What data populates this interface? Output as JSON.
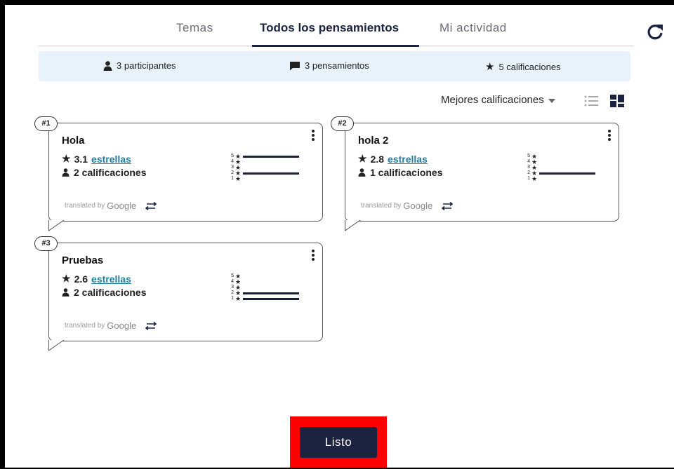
{
  "tabs": [
    "Temas",
    "Todos los pensamientos",
    "Mi actividad"
  ],
  "stats": {
    "participants": "3 participantes",
    "thoughts": "3 pensamientos",
    "ratings": "5 calificaciones"
  },
  "sort": {
    "label": "Mejores calificaciones"
  },
  "cards": [
    {
      "badge": "#1",
      "title": "Hola",
      "rating": "3.1",
      "rating_link": "estrellas",
      "count": "2 calificaciones",
      "distribution": {
        "5": 1,
        "4": 0,
        "3": 0,
        "2": 1,
        "1": 0
      }
    },
    {
      "badge": "#2",
      "title": "hola 2",
      "rating": "2.8",
      "rating_link": "estrellas",
      "count": "1 calificaciones",
      "distribution": {
        "5": 0,
        "4": 0,
        "3": 0,
        "2": 1,
        "1": 0
      }
    },
    {
      "badge": "#3",
      "title": "Pruebas",
      "rating": "2.6",
      "rating_link": "estrellas",
      "count": "2 calificaciones",
      "distribution": {
        "5": 0,
        "4": 0,
        "3": 0,
        "2": 1,
        "1": 1
      }
    }
  ],
  "translate": {
    "prefix": "translated by",
    "brand": "Google"
  },
  "dist_labels": [
    "5",
    "4",
    "3",
    "2",
    "1"
  ],
  "done_label": "Listo",
  "colors": {
    "primary": "#1c2340",
    "highlight": "#ff0000",
    "stats_bg": "#e8f2fa",
    "link": "#1d7fa6"
  }
}
